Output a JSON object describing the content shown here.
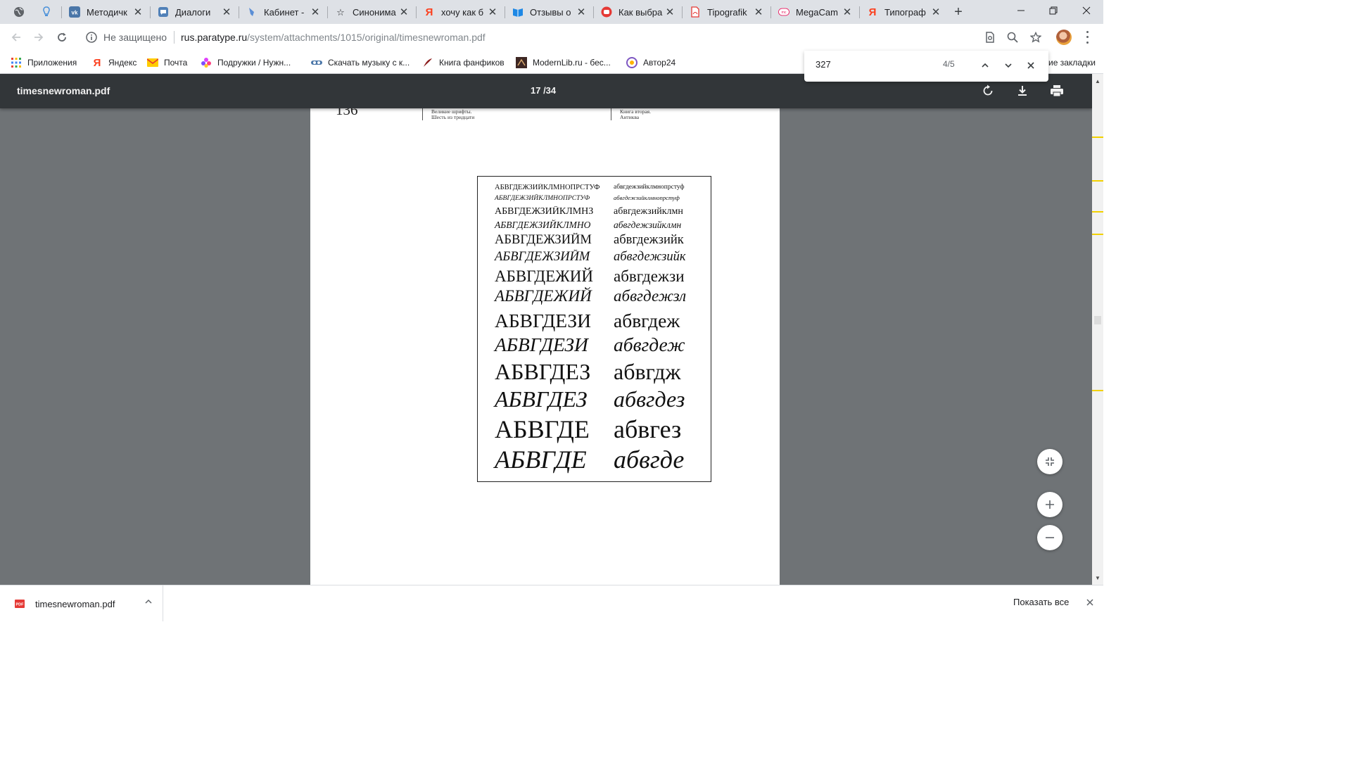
{
  "window": {
    "tabs": [
      {
        "title": "Методичк",
        "icon": "vk-icon",
        "active": false
      },
      {
        "title": "Диалоги",
        "icon": "chat-bubble-icon",
        "active": false
      },
      {
        "title": "Кабинет -",
        "icon": "feather-icon",
        "active": false
      },
      {
        "title": "Синонима",
        "icon": "star-outline-icon",
        "active": false
      },
      {
        "title": "хочу как б",
        "icon": "yandex-icon",
        "active": false
      },
      {
        "title": "Отзывы о",
        "icon": "book-icon",
        "active": false
      },
      {
        "title": "Как выбра",
        "icon": "red-circle-icon",
        "active": false
      },
      {
        "title": "Tipografik",
        "icon": "pdf-file-icon",
        "active": false
      },
      {
        "title": "MegaCam",
        "icon": "megacam-icon",
        "active": false
      },
      {
        "title": "Типограф",
        "icon": "yandex-icon",
        "active": true
      }
    ],
    "colors": {
      "tabstrip": "#dee1e6",
      "accent": "#1a73e8",
      "pdf_toolbar": "#323639",
      "viewer_bg": "#6f7376",
      "find_marker": "#f2d100"
    }
  },
  "toolbar": {
    "security_label": "Не защищено",
    "url_host": "rus.paratype.ru",
    "url_path": "/system/attachments/1015/original/timesnewroman.pdf"
  },
  "bookmarks": {
    "items": [
      {
        "label": "Приложения",
        "icon": "apps-grid-icon"
      },
      {
        "label": "Яндекс",
        "icon": "yandex-icon"
      },
      {
        "label": "Почта",
        "icon": "mail-icon"
      },
      {
        "label": "Подружки / Нужн...",
        "icon": "flower-icon"
      },
      {
        "label": "Скачать музыку с к...",
        "icon": "music-icon"
      },
      {
        "label": "Книга фанфиков",
        "icon": "quill-icon"
      },
      {
        "label": "ModernLib.ru - бес...",
        "icon": "book-dark-icon"
      },
      {
        "label": "Автор24",
        "icon": "author24-icon"
      }
    ],
    "more_label": "ие закладки"
  },
  "find": {
    "query": "327",
    "count": "4/5"
  },
  "pdf": {
    "title": "timesnewroman.pdf",
    "page_indicator": "17 /34",
    "page_number": "136",
    "header_left_1": "Великие шрифты.",
    "header_left_2": "Шесть из тридцати",
    "header_right_1": "Книга вторая.",
    "header_right_2": "Антиква",
    "specimen_rows": [
      {
        "upper": "АБВГДЕЖЗИЙКЛМНОПРСТУФ",
        "lower": "абвгдежзийклмнопрстуф",
        "italic": false
      },
      {
        "upper": "АБВГДЕЖЗИЙКЛМНОПРСТУФ",
        "lower": "абвгдежзийклмнопрстуф",
        "italic": true
      },
      {
        "upper": "АБВГДЕЖЗИЙКЛМНЗ",
        "lower": "абвгдежзийклмн",
        "italic": false
      },
      {
        "upper": "АБВГДЕЖЗИЙКЛМНО",
        "lower": "абвгдежзийклмн",
        "italic": true
      },
      {
        "upper": "АБВГДЕЖЗИЙМ",
        "lower": "абвгдежзийк",
        "italic": false
      },
      {
        "upper": "АБВГДЕЖЗИЙМ",
        "lower": "абвгдежзийк",
        "italic": true
      },
      {
        "upper": "АБВГДЕЖИЙ",
        "lower": "абвгдежзи",
        "italic": false
      },
      {
        "upper": "АБВГДЕЖИЙ",
        "lower": "абвгдежзл",
        "italic": true
      },
      {
        "upper": "АБВГДЕЗИ",
        "lower": "абвгдеж",
        "italic": false
      },
      {
        "upper": "АБВГДЕЗИ",
        "lower": "абвгдеж",
        "italic": true
      },
      {
        "upper": "АБВГДЕЗ",
        "lower": "абвгдж",
        "italic": false
      },
      {
        "upper": "АБВГДЕЗ",
        "lower": "абвгдез",
        "italic": true
      },
      {
        "upper": "АБВГДЕ",
        "lower": "абвгез",
        "italic": false
      },
      {
        "upper": "АБВГДЕ",
        "lower": "абвгде",
        "italic": true
      }
    ]
  },
  "downloads": {
    "file_name": "timesnewroman.pdf",
    "show_all_label": "Показать все"
  }
}
